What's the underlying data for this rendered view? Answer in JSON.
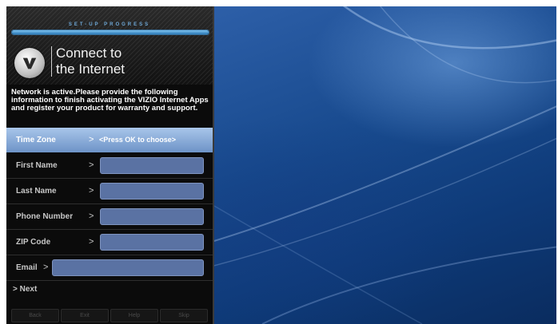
{
  "setup": {
    "progress_label": "SET-UP PROGRESS",
    "progress": 1.0,
    "title_line1": "Connect to",
    "title_line2": "the Internet",
    "info": "Network is active.Please provide the following information to finish activating the VIZIO Internet Apps and register your product for warranty and support.",
    "rows": [
      {
        "label": "Time Zone",
        "arrow": ">",
        "value": "<Press OK to choose>"
      },
      {
        "label": "First Name",
        "arrow": ">",
        "value": ""
      },
      {
        "label": "Last Name",
        "arrow": ">",
        "value": ""
      },
      {
        "label": "Phone Number",
        "arrow": ">",
        "value": ""
      },
      {
        "label": "ZIP Code",
        "arrow": ">",
        "value": ""
      },
      {
        "label": "Email",
        "arrow": ">",
        "value": ""
      }
    ],
    "next_label": "> Next",
    "buttons": [
      "Back",
      "Exit",
      "Help",
      "Skip"
    ]
  },
  "colors": {
    "selected_row": "#8fb1de",
    "field_fill": "#5a72a3",
    "progress_fill": "#4f9ad6",
    "wallpaper": "#1a4a8e"
  },
  "icons": {
    "logo": "vizio-v-logo"
  }
}
